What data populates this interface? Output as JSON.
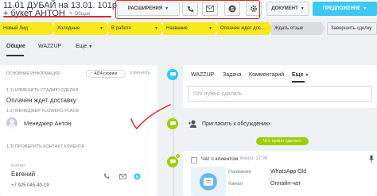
{
  "header": {
    "title_line1": "11.01 ДУБАЙ на 13.01. 101роза",
    "title_line2": "+ букет АНТОН",
    "status": "Общая",
    "buttons": {
      "extensions": "РАСШИРЕНИЯ",
      "document": "ДОКУМЕНТ",
      "offer": "ПРЕДЛОЖЕНИЕ"
    },
    "icons": [
      "phone-icon",
      "mail-icon",
      "skype-icon",
      "gear-icon"
    ]
  },
  "stages": [
    {
      "label": "Новый Лид",
      "color": "#f7e91e"
    },
    {
      "label": "Холодные",
      "color": "#f7e91e"
    },
    {
      "label": "В работе",
      "color": "#f7e91e"
    },
    {
      "label": "Название",
      "color": "#f7e91e"
    },
    {
      "label": "Оплачен ждет дос...",
      "color": "#f7e91e"
    },
    {
      "label": "Ждать отзыв",
      "color": "#d9dde0"
    },
    {
      "label": "Завершить сделку",
      "color": "#eef0f1"
    }
  ],
  "tabs": {
    "general": "Общие",
    "wazzup": "WAZZUP",
    "more": "Еще"
  },
  "left": {
    "section_title": "ОСНОВНАЯ ИНФОРМАЦИЯ",
    "ai_badge": "AI24-скоринг",
    "change_link": "изменить",
    "field1_label": "1.1) ИЗМЕНИТЬ СТАДИЮ СДЕЛКИ",
    "field1_value": "Оплачен ждет доставку",
    "field2_label": "1.2) МЕНЕДЖЕР FLOWERS PLACE",
    "manager_name": "Менеджер Антон",
    "field3_label": "1.3) ПРОВЕРИТЬ КОНТАКТ КЛИЕНТА",
    "contact_label": "Контакт",
    "contact_name": "Евгений",
    "contact_phone": "+7 925 045-40-19"
  },
  "right": {
    "tabs": [
      "WAZZUP",
      "Задача",
      "Комментарий",
      "Еще"
    ],
    "todo_placeholder": "Что нужно сделать",
    "invite_text": "Пригласить к обсуждению",
    "pill_text": "Что нужно сделать",
    "chat": {
      "title": "Чат с клиентом",
      "time": "вчера, 17:38",
      "name_label": "Название",
      "name_value": "WhatsApp Old",
      "channel_label": "Канал",
      "channel_value": "Онлайн-чат"
    },
    "badge_count": "1"
  },
  "colors": {
    "accent": "#3bc8f5",
    "stage_active": "#f7e91e",
    "timeline_green": "#9dcf00",
    "annotation_red": "#d62b2b"
  }
}
